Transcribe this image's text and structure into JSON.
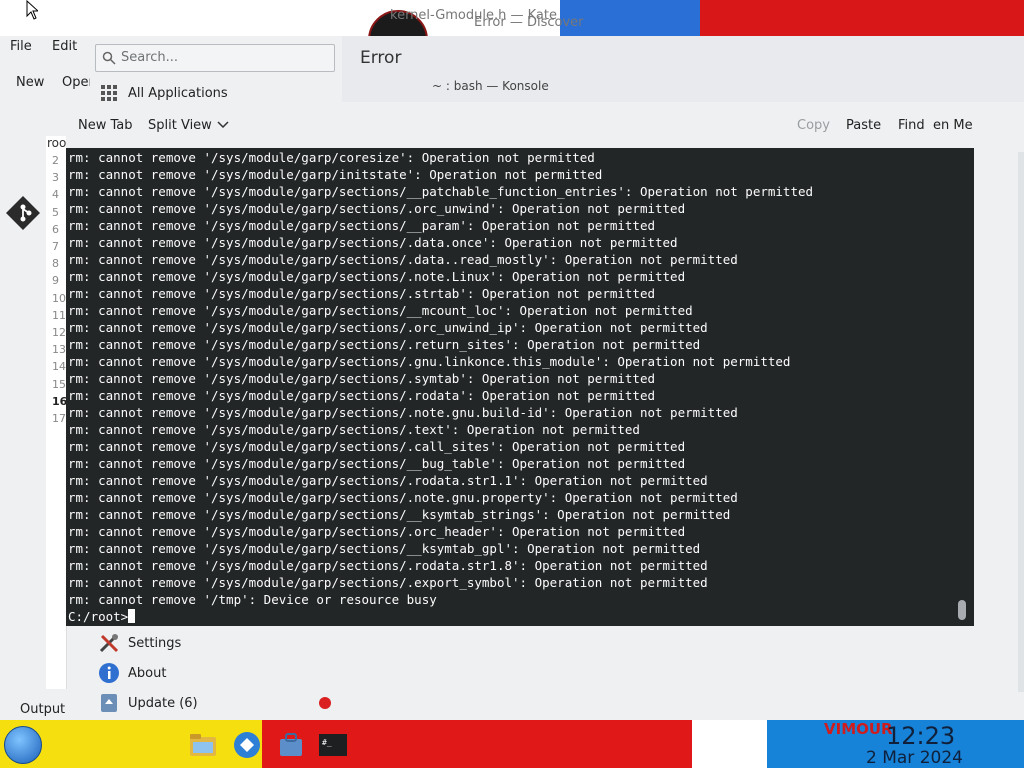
{
  "top": {
    "kate_title": "kernel-Gmodule.h — Kate",
    "discover_title": "Error — Discover"
  },
  "kate": {
    "menu": [
      "File",
      "Edit"
    ],
    "toolbar": [
      "New",
      "Open"
    ],
    "doc_root": "roo",
    "line_numbers": [
      "2",
      "3",
      "4",
      "5",
      "6",
      "7",
      "8",
      "9",
      "10",
      "11",
      "12",
      "13",
      "14",
      "15",
      "16",
      "17"
    ],
    "output_label": "Output"
  },
  "launcher": {
    "search_placeholder": "Search...",
    "all_apps": "All Applications",
    "error_title": "Error",
    "settings": "Settings",
    "about": "About",
    "update": "Update (6)"
  },
  "konsole": {
    "title": "~ : bash — Konsole",
    "toolbar": {
      "new_tab": "New Tab",
      "split_view": "Split View",
      "copy": "Copy",
      "paste": "Paste",
      "find": "Find",
      "menu": "en Me"
    },
    "lines": [
      "rm: cannot remove '/sys/module/garp/coresize': Operation not permitted",
      "rm: cannot remove '/sys/module/garp/initstate': Operation not permitted",
      "rm: cannot remove '/sys/module/garp/sections/__patchable_function_entries': Operation not permitted",
      "rm: cannot remove '/sys/module/garp/sections/.orc_unwind': Operation not permitted",
      "rm: cannot remove '/sys/module/garp/sections/__param': Operation not permitted",
      "rm: cannot remove '/sys/module/garp/sections/.data.once': Operation not permitted",
      "rm: cannot remove '/sys/module/garp/sections/.data..read_mostly': Operation not permitted",
      "rm: cannot remove '/sys/module/garp/sections/.note.Linux': Operation not permitted",
      "rm: cannot remove '/sys/module/garp/sections/.strtab': Operation not permitted",
      "rm: cannot remove '/sys/module/garp/sections/__mcount_loc': Operation not permitted",
      "rm: cannot remove '/sys/module/garp/sections/.orc_unwind_ip': Operation not permitted",
      "rm: cannot remove '/sys/module/garp/sections/.return_sites': Operation not permitted",
      "rm: cannot remove '/sys/module/garp/sections/.gnu.linkonce.this_module': Operation not permitted",
      "rm: cannot remove '/sys/module/garp/sections/.symtab': Operation not permitted",
      "rm: cannot remove '/sys/module/garp/sections/.rodata': Operation not permitted",
      "rm: cannot remove '/sys/module/garp/sections/.note.gnu.build-id': Operation not permitted",
      "rm: cannot remove '/sys/module/garp/sections/.text': Operation not permitted",
      "rm: cannot remove '/sys/module/garp/sections/.call_sites': Operation not permitted",
      "rm: cannot remove '/sys/module/garp/sections/__bug_table': Operation not permitted",
      "rm: cannot remove '/sys/module/garp/sections/.rodata.str1.1': Operation not permitted",
      "rm: cannot remove '/sys/module/garp/sections/.note.gnu.property': Operation not permitted",
      "rm: cannot remove '/sys/module/garp/sections/__ksymtab_strings': Operation not permitted",
      "rm: cannot remove '/sys/module/garp/sections/.orc_header': Operation not permitted",
      "rm: cannot remove '/sys/module/garp/sections/__ksymtab_gpl': Operation not permitted",
      "rm: cannot remove '/sys/module/garp/sections/.rodata.str1.8': Operation not permitted",
      "rm: cannot remove '/sys/module/garp/sections/.export_symbol': Operation not permitted",
      "rm: cannot remove '/tmp': Device or resource busy"
    ],
    "prompt": "C:/root>"
  },
  "taskbar": {
    "time": "12:23",
    "date": "2 Mar 2024"
  },
  "colors": {
    "terminal_bg": "#232627",
    "terminal_fg": "#fcfcfc",
    "taskbar_yellow": "#f6df0f",
    "taskbar_red": "#e01818",
    "taskbar_blue": "#1682d8"
  }
}
